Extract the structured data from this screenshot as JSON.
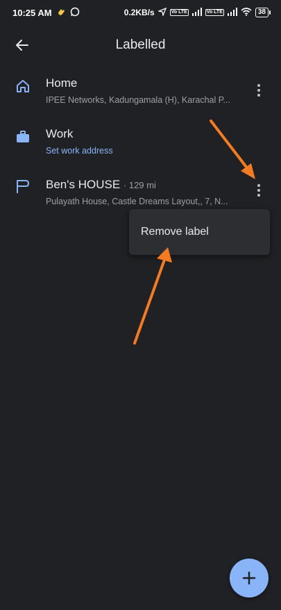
{
  "status": {
    "time": "10:25 AM",
    "speed": "0.2KB/s",
    "battery": "38",
    "volte_badge": "Vo LTE"
  },
  "header": {
    "title": "Labelled"
  },
  "places": [
    {
      "name": "Home",
      "distance": "",
      "subtitle": "IPEE Networks, Kadungamala (H), Karachal P..."
    },
    {
      "name": "Work",
      "distance": "",
      "subtitle": "Set work address"
    },
    {
      "name": "Ben's HOUSE",
      "distance": "· 129 mi",
      "subtitle": "Pulayath House, Castle Dreams Layout,, 7, N..."
    }
  ],
  "menu": {
    "remove_label": "Remove label"
  },
  "colors": {
    "background": "#202124",
    "accent": "#8ab4f8",
    "annotation": "#f47b20"
  }
}
